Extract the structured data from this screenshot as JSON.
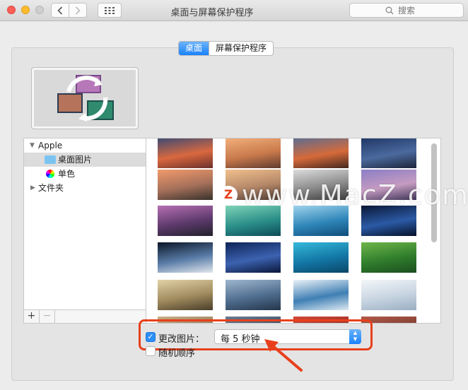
{
  "window": {
    "title": "桌面与屏幕保护程序",
    "search_placeholder": "搜索"
  },
  "tabs": [
    {
      "label": "桌面",
      "active": true
    },
    {
      "label": "屏幕保护程序",
      "active": false
    }
  ],
  "sidebar": {
    "items": [
      {
        "label": "Apple",
        "icon": "disclosure-open"
      },
      {
        "label": "桌面图片",
        "icon": "folder-icon",
        "selected": true
      },
      {
        "label": "单色",
        "icon": "color-wheel-icon"
      },
      {
        "label": "文件夹",
        "icon": "disclosure-closed"
      }
    ],
    "add_label": "+",
    "remove_label": "−"
  },
  "thumbnails": [
    {
      "name": "sierra-mountain",
      "colors": [
        "#3b4a73",
        "#d9683f",
        "#6b2f2c"
      ]
    },
    {
      "name": "sierra-dusk",
      "colors": [
        "#f2b07c",
        "#c97a4c",
        "#5f3b2e"
      ]
    },
    {
      "name": "el-capitan-sunset",
      "colors": [
        "#5b6d91",
        "#d66a3a",
        "#42271f"
      ]
    },
    {
      "name": "mountain-blue",
      "colors": [
        "#1e3664",
        "#4b6a9e",
        "#1c2539"
      ]
    },
    {
      "name": "yosemite-dome",
      "colors": [
        "#f29a6b",
        "#a5705a",
        "#38312b"
      ]
    },
    {
      "name": "yosemite-sunrise",
      "colors": [
        "#f2c08d",
        "#b48768",
        "#4d3a31"
      ]
    },
    {
      "name": "yosemite-valley",
      "colors": [
        "#dcdcdc",
        "#8a8a8a",
        "#3a3a3a"
      ]
    },
    {
      "name": "yosemite-purple",
      "colors": [
        "#8c7ec6",
        "#c59bc1",
        "#3e3557"
      ]
    },
    {
      "name": "lake-rocks",
      "colors": [
        "#b66fb3",
        "#5d3a6c",
        "#22202b"
      ]
    },
    {
      "name": "green-wave",
      "colors": [
        "#7fd3b7",
        "#2b8f89",
        "#0d4b58"
      ]
    },
    {
      "name": "ocean-wave",
      "colors": [
        "#9fd3ec",
        "#2f86b9",
        "#0f4d79"
      ]
    },
    {
      "name": "earth-horizon",
      "colors": [
        "#0a1735",
        "#2b5aa5",
        "#06112a"
      ]
    },
    {
      "name": "earth-night",
      "colors": [
        "#0b1627",
        "#5a7da8",
        "#e1e6ec"
      ]
    },
    {
      "name": "milky-way",
      "colors": [
        "#0e2458",
        "#3c62b0",
        "#0a1739"
      ]
    },
    {
      "name": "reef-aerial",
      "colors": [
        "#35b9d9",
        "#1377a6",
        "#0a4667"
      ]
    },
    {
      "name": "green-field",
      "colors": [
        "#6fb64a",
        "#2f7d2c",
        "#1d4d1f"
      ]
    },
    {
      "name": "foggy-forest",
      "colors": [
        "#e2d2a6",
        "#a08b5e",
        "#4a3e2a"
      ]
    },
    {
      "name": "misty-hills",
      "colors": [
        "#9fb6cf",
        "#4f6d8e",
        "#24364b"
      ]
    },
    {
      "name": "ice-river",
      "colors": [
        "#eaf2f7",
        "#3f7fb4",
        "#dce8f1"
      ]
    },
    {
      "name": "snow-dunes",
      "colors": [
        "#f3f6f9",
        "#c7d4e1",
        "#9aaec2"
      ]
    },
    {
      "name": "partial-1",
      "colors": [
        "#c8b08a",
        "#8a6e4d",
        "#4c3a28"
      ]
    },
    {
      "name": "partial-2",
      "colors": [
        "#6a7d92",
        "#33485e",
        "#1b2634"
      ]
    },
    {
      "name": "partial-3",
      "colors": [
        "#d14a3a",
        "#8e2a21",
        "#4d1611"
      ]
    },
    {
      "name": "partial-4",
      "colors": [
        "#b05b4b",
        "#78382d",
        "#3e1d16"
      ]
    }
  ],
  "options": {
    "change_picture_label": "更改图片：",
    "change_picture_checked": true,
    "interval_value": "每 5 秒钟",
    "random_order_label": "随机顺序",
    "random_order_checked": false
  },
  "watermark": {
    "logo_letter": "Z",
    "text": "www.MacZ.com"
  },
  "colors": {
    "accent_blue": "#1a82fb",
    "highlight_red": "#e8401c"
  }
}
